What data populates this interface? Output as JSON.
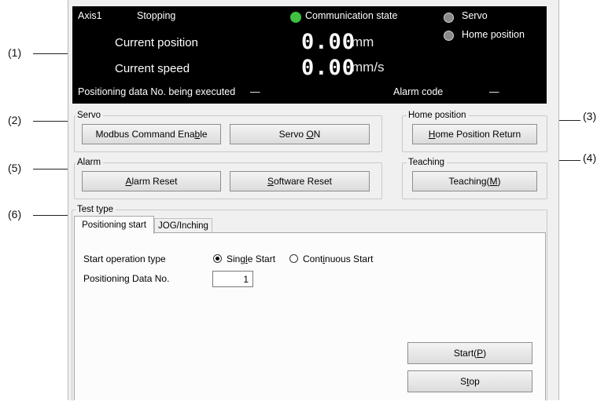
{
  "callouts": [
    "(1)",
    "(2)",
    "(3)",
    "(4)",
    "(5)",
    "(6)"
  ],
  "status": {
    "axis": "Axis1",
    "state": "Stopping",
    "communication_label": "Communication state",
    "servo_label": "Servo",
    "home_label": "Home position",
    "position_label": "Current position",
    "position_value": "0.00",
    "position_unit": "mm",
    "speed_label": "Current speed",
    "speed_value": "0.00",
    "speed_unit": "mm/s",
    "exec_label": "Positioning data No. being executed",
    "exec_value": "—",
    "alarm_label": "Alarm code",
    "alarm_value": "—",
    "colors": {
      "communication_lamp": "#3fc13f",
      "servo_lamp": "#8a8a8a",
      "home_lamp": "#8a8a8a",
      "background": "#000000"
    }
  },
  "servo_group": {
    "title": "Servo",
    "modbus_button": {
      "pre": "Modbus Command Ena",
      "key": "b",
      "post": "le"
    },
    "servo_on_button": {
      "pre": "Servo ",
      "key": "O",
      "post": "N"
    }
  },
  "home_group": {
    "title": "Home position",
    "return_button": {
      "pre": "",
      "key": "H",
      "post": "ome Position Return"
    }
  },
  "alarm_group": {
    "title": "Alarm",
    "alarm_reset_button": {
      "pre": "",
      "key": "A",
      "post": "larm Reset"
    },
    "software_reset_button": {
      "pre": "",
      "key": "S",
      "post": "oftware Reset"
    }
  },
  "teaching_group": {
    "title": "Teaching",
    "teaching_button": {
      "pre": "Teaching(",
      "key": "M",
      "post": ")"
    }
  },
  "test_type": {
    "title": "Test type",
    "tabs": [
      "Positioning start",
      "JOG/Inching"
    ],
    "start_operation_label": "Start operation type",
    "single_start": {
      "pre": "Sing",
      "key": "l",
      "post": "e Start"
    },
    "continuous_start": {
      "pre": "Cont",
      "key": "i",
      "post": "nuous Start"
    },
    "selected": "Single Start",
    "data_no_label": {
      "pre": "Positionin",
      "key": "g",
      "post": " Data No."
    },
    "data_no_value": "1",
    "start_button": {
      "pre": "Start(",
      "key": "P",
      "post": ")"
    },
    "stop_button": {
      "pre": "S",
      "key": "t",
      "post": "op"
    }
  }
}
